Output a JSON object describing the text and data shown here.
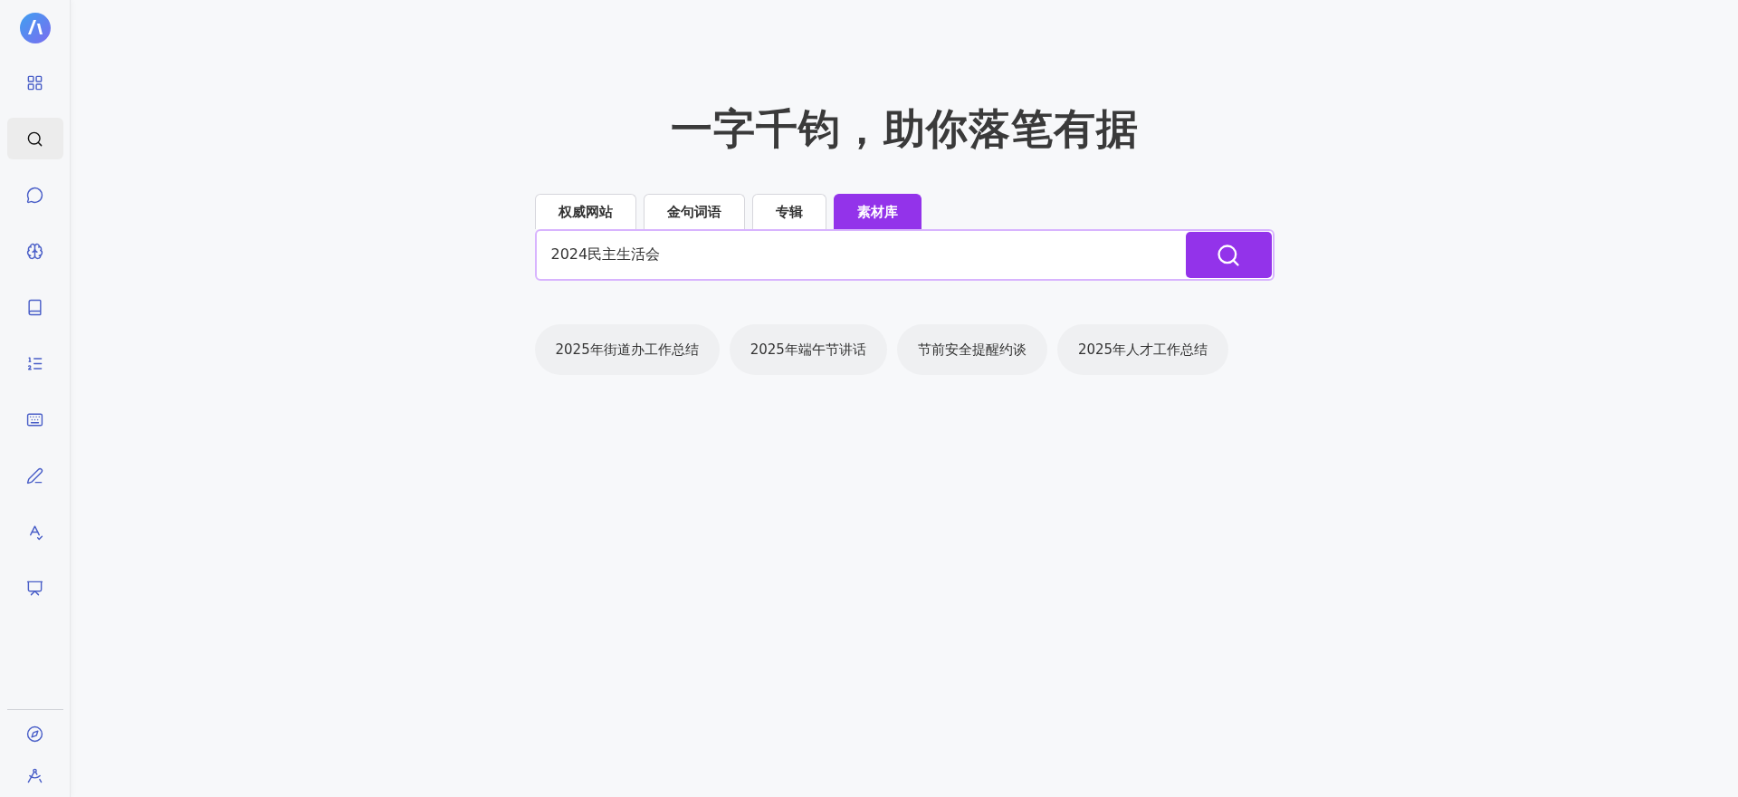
{
  "sidebar": {
    "items": [
      {
        "selected": false
      },
      {
        "selected": true
      },
      {
        "selected": false
      },
      {
        "selected": false
      },
      {
        "selected": false
      },
      {
        "selected": false
      },
      {
        "selected": false
      },
      {
        "selected": false
      },
      {
        "selected": false
      },
      {
        "selected": false
      }
    ],
    "bottom_items": [
      {
        "selected": false
      },
      {
        "selected": false
      }
    ]
  },
  "headline": "一字千钧，助你落笔有据",
  "tabs": [
    {
      "label": "权威网站",
      "selected": false
    },
    {
      "label": "金句词语",
      "selected": false
    },
    {
      "label": "专辑",
      "selected": false
    },
    {
      "label": "素材库",
      "selected": true
    }
  ],
  "search": {
    "value": "2024民主生活会"
  },
  "suggestions": [
    "2025年街道办工作总结",
    "2025年端午节讲话",
    "节前安全提醒约谈",
    "2025年人才工作总结"
  ]
}
